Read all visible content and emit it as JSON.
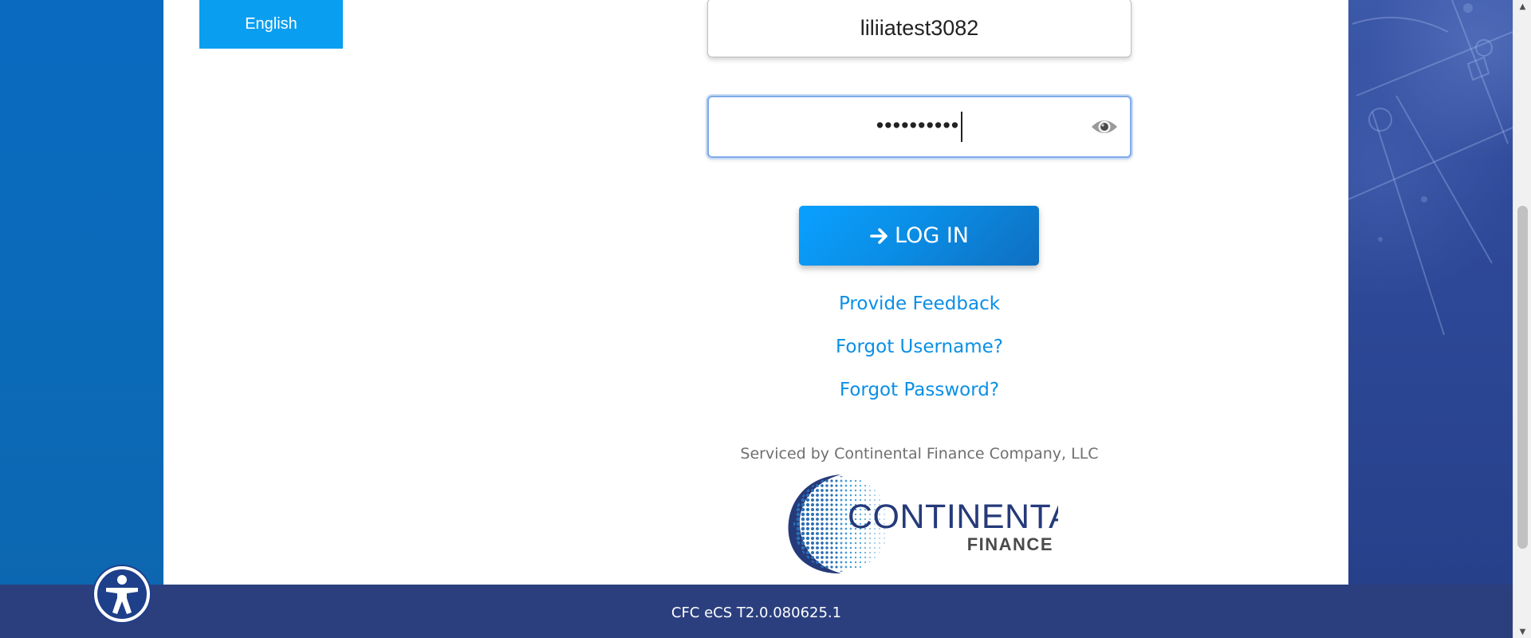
{
  "language": {
    "label": "English"
  },
  "form": {
    "username_value": "liliiatest3082",
    "password_value": "••••••••••",
    "login_label": "LOG IN"
  },
  "links": {
    "feedback": "Provide Feedback",
    "forgot_username": "Forgot Username?",
    "forgot_password": "Forgot Password?"
  },
  "serviced_by": "Serviced by Continental Finance Company, LLC",
  "logo": {
    "name": "CONTINENTAL",
    "sub": "FINANCE"
  },
  "footer": {
    "version": "CFC eCS T2.0.080625.1"
  },
  "icons": {
    "eye": "eye-icon",
    "arrow": "arrow-right-icon",
    "accessibility": "accessibility-icon"
  },
  "colors": {
    "primary_blue": "#0a9ef0",
    "link_blue": "#0a8fe6",
    "footer_navy": "#2b3f7f",
    "logo_navy": "#253a7a"
  }
}
